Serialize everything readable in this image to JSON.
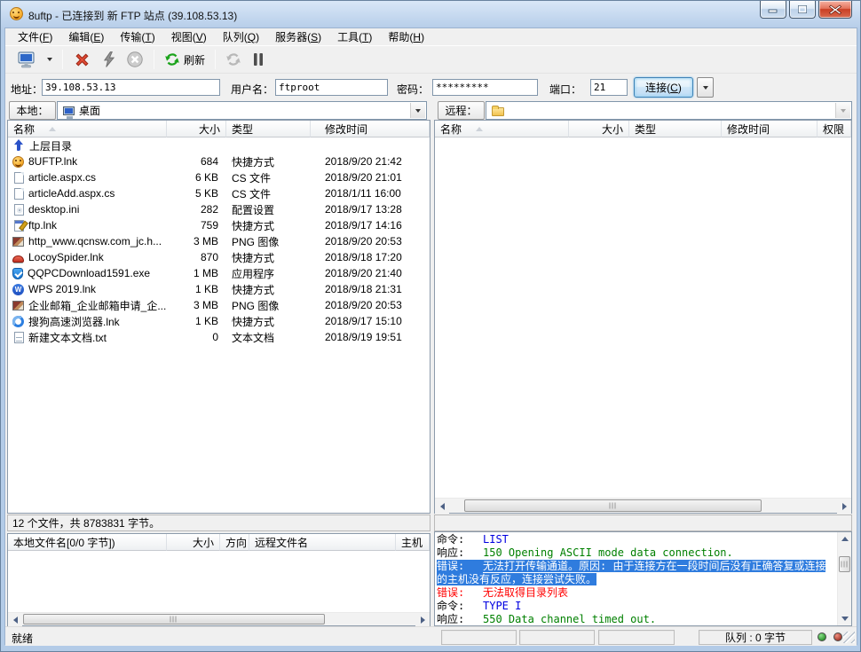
{
  "window": {
    "title": "8uftp - 已连接到 新 FTP 站点 (39.108.53.13)"
  },
  "menu": {
    "items": [
      {
        "pre": "文件(",
        "key": "F",
        "post": ")"
      },
      {
        "pre": "编辑(",
        "key": "E",
        "post": ")"
      },
      {
        "pre": "传输(",
        "key": "T",
        "post": ")"
      },
      {
        "pre": "视图(",
        "key": "V",
        "post": ")"
      },
      {
        "pre": "队列(",
        "key": "Q",
        "post": ")"
      },
      {
        "pre": "服务器(",
        "key": "S",
        "post": ")"
      },
      {
        "pre": "工具(",
        "key": "T",
        "post": ")"
      },
      {
        "pre": "帮助(",
        "key": "H",
        "post": ")"
      }
    ]
  },
  "toolbar": {
    "refresh_label": "刷新"
  },
  "connection": {
    "address_label": "地址：",
    "address_value": "39.108.53.13",
    "user_label": "用户名：",
    "user_value": "ftproot",
    "password_label": "密码：",
    "password_value": "*********",
    "port_label": "端口：",
    "port_value": "21",
    "connect": {
      "pre": "连接(",
      "key": "C",
      "post": ")"
    }
  },
  "local_pane": {
    "label": "本地：",
    "path": "桌面",
    "columns": {
      "name": "名称",
      "size": "大小",
      "type": "类型",
      "modified": "修改时间"
    },
    "up_dir": "上层目录",
    "files": [
      {
        "icon": "ftp-app-icon",
        "name": "8UFTP.lnk",
        "size": "684",
        "type": "快捷方式",
        "modified": "2018/9/20 21:42"
      },
      {
        "icon": "file-icon",
        "name": "article.aspx.cs",
        "size": "6 KB",
        "type": "CS 文件",
        "modified": "2018/9/20 21:01"
      },
      {
        "icon": "file-icon",
        "name": "articleAdd.aspx.cs",
        "size": "5 KB",
        "type": "CS 文件",
        "modified": "2018/1/11 16:00"
      },
      {
        "icon": "config-file-icon",
        "name": "desktop.ini",
        "size": "282",
        "type": "配置设置",
        "modified": "2018/9/17 13:28"
      },
      {
        "icon": "notepad-icon",
        "name": "ftp.lnk",
        "size": "759",
        "type": "快捷方式",
        "modified": "2018/9/17 14:16"
      },
      {
        "icon": "image-file-icon",
        "name": "http_www.qcnsw.com_jc.h...",
        "size": "3 MB",
        "type": "PNG 图像",
        "modified": "2018/9/20 20:53"
      },
      {
        "icon": "locoy-spider-icon",
        "name": "LocoySpider.lnk",
        "size": "870",
        "type": "快捷方式",
        "modified": "2018/9/18 17:20"
      },
      {
        "icon": "qq-shield-icon",
        "name": "QQPCDownload1591.exe",
        "size": "1 MB",
        "type": "应用程序",
        "modified": "2018/9/20 21:40"
      },
      {
        "icon": "wps-icon",
        "name": "WPS 2019.lnk",
        "size": "1 KB",
        "type": "快捷方式",
        "modified": "2018/9/18 21:31"
      },
      {
        "icon": "image-file-icon",
        "name": "企业邮箱_企业邮箱申请_企...",
        "size": "3 MB",
        "type": "PNG 图像",
        "modified": "2018/9/20 20:53"
      },
      {
        "icon": "sogou-icon",
        "name": "搜狗高速浏览器.lnk",
        "size": "1 KB",
        "type": "快捷方式",
        "modified": "2018/9/17 15:10"
      },
      {
        "icon": "text-file-icon",
        "name": "新建文本文档.txt",
        "size": "0",
        "type": "文本文档",
        "modified": "2018/9/19 19:51"
      }
    ],
    "status": "12 个文件，共 8783831 字节。"
  },
  "remote_pane": {
    "label": "远程：",
    "columns": {
      "name": "名称",
      "size": "大小",
      "type": "类型",
      "modified": "修改时间",
      "perm": "权限"
    }
  },
  "queue_pane": {
    "columns": {
      "local": "本地文件名[0/0 字节])",
      "size": "大小",
      "direction": "方向",
      "remote": "远程文件名",
      "host": "主机"
    }
  },
  "log": {
    "lines": [
      {
        "prefix": "命令:",
        "text": "LIST"
      },
      {
        "prefix": "响应:",
        "text": "150 Opening ASCII mode data connection."
      },
      {
        "prefix": "错误:",
        "text": "无法打开传输通道。原因: 由于连接方在一段时间后没有正确答复或连接的主机没有反应，连接尝试失败。"
      },
      {
        "prefix": "错误:",
        "text": "无法取得目录列表"
      },
      {
        "prefix": "命令:",
        "text": "TYPE I"
      },
      {
        "prefix": "响应:",
        "text": "550 Data channel timed out."
      }
    ]
  },
  "status_bar": {
    "ready": "就绪",
    "queue": "队列 : 0 字节"
  },
  "colors": {
    "selection": "#2f7cde",
    "command_text": "#0000e0",
    "response_text": "#008000",
    "error_text": "#ff0000",
    "titlebar": "#b3cbe7",
    "close_button": "#c93f24"
  }
}
